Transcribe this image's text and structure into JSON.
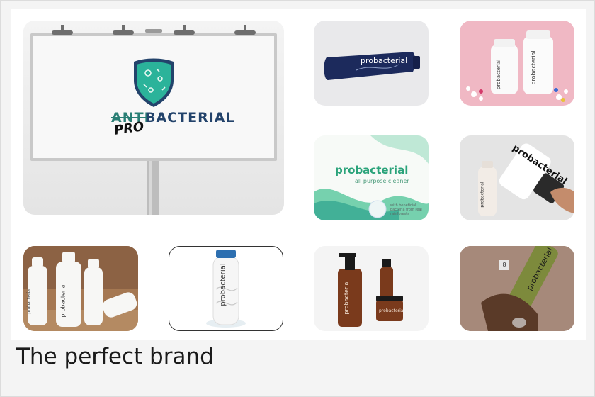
{
  "caption": "The perfect brand",
  "colors": {
    "brand_green": "#2aa37a",
    "brand_teal": "#1f9a87",
    "navy": "#1c2a5c",
    "amber": "#7a3a1c",
    "pink_bg": "#f0b8c4",
    "olive": "#7d8a3c"
  },
  "billboard": {
    "old_word": "ANTI",
    "prefix": "PRO",
    "word": "BACTERIAL"
  },
  "brand_name": "probacterial",
  "cleaner": {
    "brand": "probacterial",
    "subtitle": "all purpose cleaner",
    "badge_text": "with beneficial bacteria from real rainforests"
  },
  "badge_number": "8"
}
